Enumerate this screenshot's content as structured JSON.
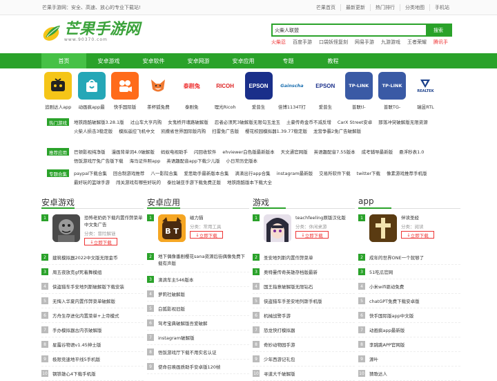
{
  "topbar": {
    "slogan": "芒果手游网：安全、高速、放心的专业下载站!",
    "links": [
      "芒果首页",
      "最新更新",
      "热门排行",
      "分类地图",
      "手机站"
    ]
  },
  "logo": {
    "title": "芒果手游网",
    "url": "www.90370.com"
  },
  "search": {
    "value": "火柴人联盟",
    "button": "搜索"
  },
  "hotwords": [
    {
      "text": "火柴忍",
      "red": true
    },
    {
      "text": "百度手游",
      "red": false
    },
    {
      "text": "口袋妖怪复刻",
      "red": false
    },
    {
      "text": "网易手游",
      "red": false
    },
    {
      "text": "九游游戏",
      "red": false
    },
    {
      "text": "王者荣耀",
      "red": false
    },
    {
      "text": "腾讯手",
      "red": true
    }
  ],
  "nav": [
    "首页",
    "安卓游戏",
    "安卓软件",
    "安卓网游",
    "安卓应用",
    "专题",
    "教程"
  ],
  "apps": [
    {
      "name": "追剧达人app",
      "icon": "tv-icon",
      "bg": "#f5c518",
      "label": ""
    },
    {
      "name": "动画疯app最",
      "icon": "bag-icon",
      "bg": "#25a7b7",
      "label": ""
    },
    {
      "name": "快手国际版",
      "icon": "camera-icon",
      "bg": "#ff6b1a",
      "label": ""
    },
    {
      "name": "茶杯狐免费",
      "icon": "fox-icon",
      "bg": "#ffffff",
      "label": ""
    },
    {
      "name": "泰剧免",
      "icon": "taiju-icon",
      "bg": "#ffffff",
      "label": "泰剧兔"
    },
    {
      "name": "理光Ricoh",
      "icon": "ricoh-icon",
      "bg": "#ffffff",
      "label": "RICOH"
    },
    {
      "name": "爱普生",
      "icon": "epson-icon",
      "bg": "#1a2f8a",
      "label": "EPSON"
    },
    {
      "name": "佳博1134T打",
      "icon": "gainscha-icon",
      "bg": "#ffffff",
      "label": "Gainscha"
    },
    {
      "name": "爱普生",
      "icon": "epson2-icon",
      "bg": "#ffffff",
      "label": "EPSON"
    },
    {
      "name": "普联tl-",
      "icon": "tplink-icon",
      "bg": "#3a5aa5",
      "label": "TP-LINK"
    },
    {
      "name": "普联TG-",
      "icon": "tplink2-icon",
      "bg": "#3a5aa5",
      "label": "TP-LINK"
    },
    {
      "name": "瑞昱RTL",
      "icon": "realtek-icon",
      "bg": "#ffffff",
      "label": "REALTEK"
    }
  ],
  "tags": [
    {
      "label": "热门游戏",
      "items": [
        "地铁跑酷破解版3.28.1版",
        "过山车大亨内购",
        "女鬼桥开魂路破解版",
        "忍者必须死3破解版无限勾玉龙玉",
        "土豪传奇金币不减反增",
        "CarX Street安卓",
        "那落冲突破解版无限资源",
        "火柴人损击3稳定版",
        "模拟遥控飞机中文",
        "凯撒省世界国际版内购",
        "扫雷免广告版",
        "樱花校园模拟器1.39.77稳定版",
        "龙营争霸2免广告破解版"
      ]
    },
    {
      "label": "推荐应用",
      "items": [
        "巴顿影视纯净版",
        "漫画背单词4.0破解版",
        "蚂蚁电视助手",
        "闪回收软件",
        "ehviewer白色版最新版本",
        "天文通官网版",
        "英语趣配音7.55版本",
        "成考辅导最新版",
        "悬浮秒表1.0",
        "悟饭游戏厅免广告版下载",
        "海马证件照app",
        "英语趣配音app下载少儿版",
        "小日常历史版本"
      ]
    },
    {
      "label": "专题合集",
      "items": [
        "paypal下载合集",
        "回合制游戏推荐",
        "八一影院合集",
        "爱思助手最新版本合集",
        "滴滴出行app合集",
        "instagram最新版",
        "交易所软件下载",
        "twitter下载",
        "像素游戏推荐手机版",
        "最好玩的篮球手游",
        "闯关游戏有哪些好玩的",
        "泰拉瑞亚手游下载免费正版",
        "地铁跑酷版本下载大全"
      ]
    }
  ],
  "columns": [
    {
      "title": "安卓游戏",
      "feature": {
        "name": "恐怖老奶奶下载内置作弊菜单中文免广告",
        "category": "分类：冒险解谜",
        "download": "立即下载",
        "icon": "granny-icon"
      },
      "items": [
        "建筑模拟器2022中文版无限金币",
        "周五夜放克gf死着舞模组",
        "侠盗猎车手安地列斯破解版下载安装",
        "无悔入华夏内置作弊菜单破解版",
        "方舟生存进化内置菜单+上帝模式",
        "手办模拟器古内衣破解版",
        "星露谷物语v1.45绅士版",
        "极限竞速地平线5手机版",
        "钢铁雄心4下载手机版"
      ]
    },
    {
      "title": "安卓应用",
      "feature": {
        "name": "磁力猫",
        "category": "分类：常用工具",
        "download": "立即下载",
        "icon": "bt-icon"
      },
      "items": [
        "地下偶像番剧樱花sana资源后街偶像免费下载有声版",
        "滴滴车主546版本",
        "萝莉社破解版",
        "白狐影视旧版",
        "驾考宝典破解版吾爱破解",
        "instagram破解版",
        "悟饭游戏厅下载不用实名认证",
        "使命召唤画质助手安卓版120帧"
      ]
    },
    {
      "title": "游戏",
      "feature": {
        "name": "teachfeeling原版汉化版",
        "category": "分类：休闲桌游",
        "download": "立即下载",
        "icon": "anime-girl-icon"
      },
      "items": [
        "圣安地列斯内置作弊菜单",
        "奥特曼传奇英雄存档版最新",
        "国王指意破解版无限钻石",
        "侠盗猎车手圣安地列斯手机版",
        "机械战警手游",
        "恐龙快打模拟器",
        "奇妙动物园手游",
        "少年西游记礼包",
        "寻道大千破解版"
      ]
    },
    {
      "title": "app",
      "feature": {
        "name": "伴读圣经",
        "category": "分类：阅读",
        "download": "立即下载",
        "icon": "cross-icon"
      },
      "items": [
        "成年的世界ONE一个就够了",
        "51吃瓜官网",
        "小米wifi驱动免费",
        "chatGPT免费下载安卓版",
        "快手国际版app中文版",
        "动画疯app最新版",
        "李跳跳APP官网版",
        "源叶",
        "猜歌达人"
      ]
    }
  ]
}
